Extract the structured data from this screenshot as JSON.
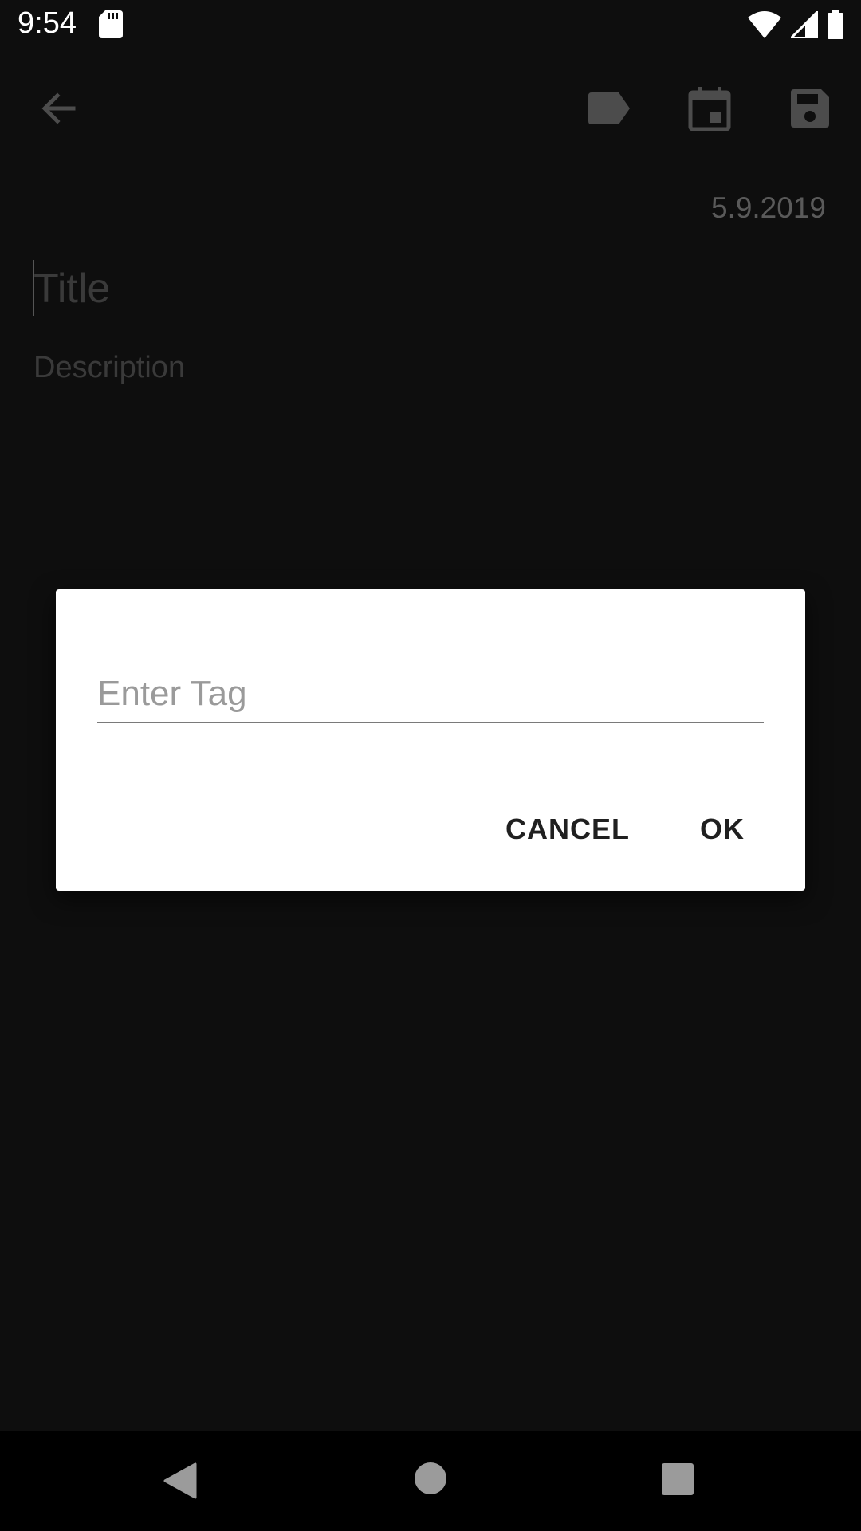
{
  "status_bar": {
    "time": "9:54",
    "icons": [
      "sd-card-icon",
      "wifi-icon",
      "signal-icon",
      "battery-icon"
    ]
  },
  "app_bar": {
    "icons": [
      "back-arrow-icon",
      "tag-icon",
      "calendar-icon",
      "save-icon"
    ]
  },
  "note": {
    "date": "5.9.2019",
    "title_placeholder": "Title",
    "description_placeholder": "Description"
  },
  "dialog": {
    "tag_placeholder": "Enter Tag",
    "cancel_label": "CANCEL",
    "ok_label": "OK"
  },
  "nav_bar": {
    "icons": [
      "nav-back-icon",
      "nav-home-icon",
      "nav-recents-icon"
    ]
  },
  "colors": {
    "background": "#0e0e0e",
    "dialog": "#ffffff",
    "dim_text": "#3a3a3a"
  }
}
